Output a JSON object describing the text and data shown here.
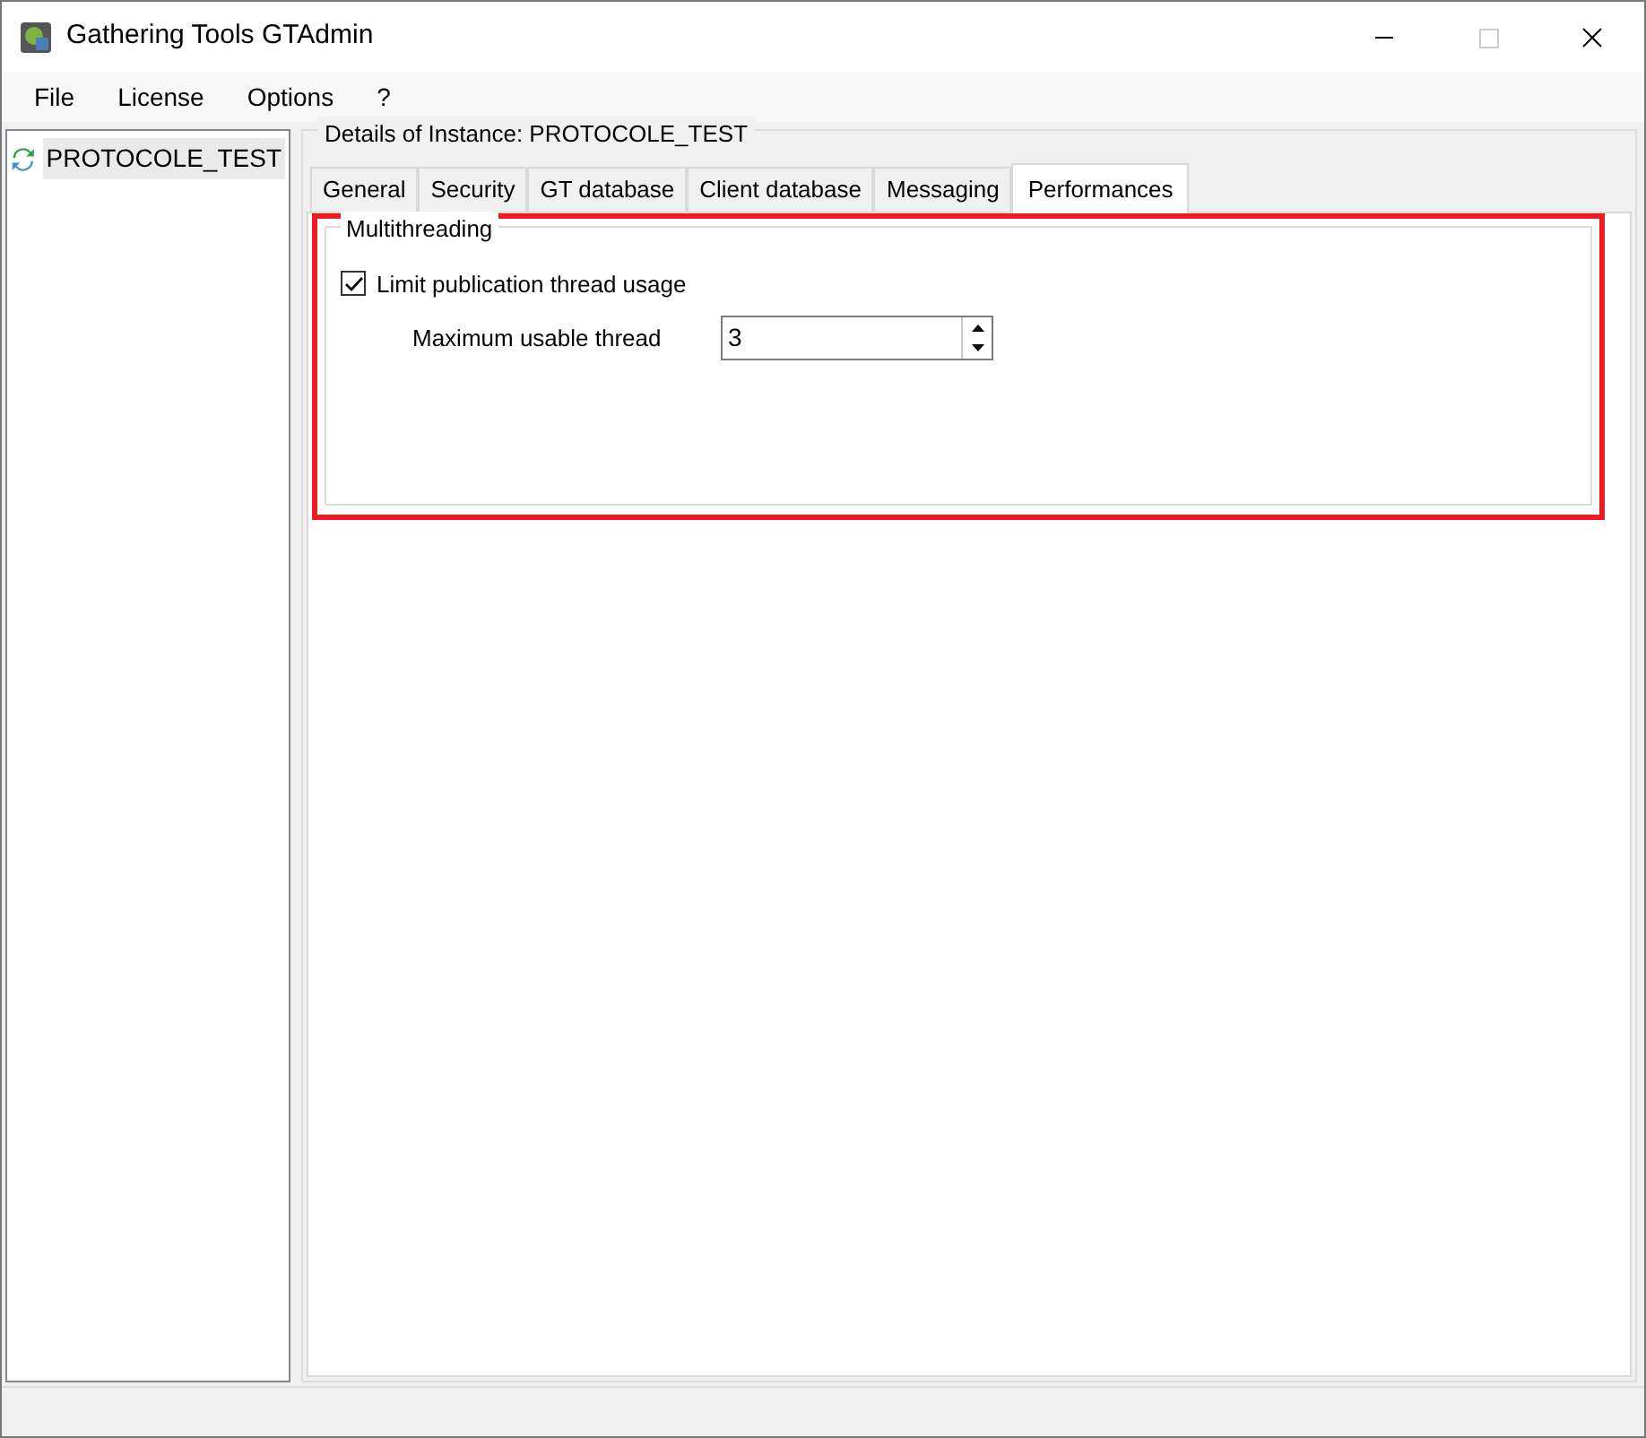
{
  "window": {
    "title": "Gathering Tools GTAdmin"
  },
  "menu": [
    "File",
    "License",
    "Options",
    "?"
  ],
  "tree": [
    {
      "label": "PROTOCOLE_TEST",
      "selected": true
    }
  ],
  "details": {
    "title": "Details of Instance: PROTOCOLE_TEST",
    "tabs": [
      {
        "label": "General",
        "selected": false
      },
      {
        "label": "Security",
        "selected": false
      },
      {
        "label": "GT database",
        "selected": false
      },
      {
        "label": "Client database",
        "selected": false
      },
      {
        "label": "Messaging",
        "selected": false
      },
      {
        "label": "Performances",
        "selected": true
      }
    ],
    "group": {
      "title": "Multithreading",
      "checkbox": {
        "label": "Limit publication thread usage",
        "checked": true
      },
      "spinner": {
        "label": "Maximum usable thread",
        "value": "3"
      }
    }
  }
}
